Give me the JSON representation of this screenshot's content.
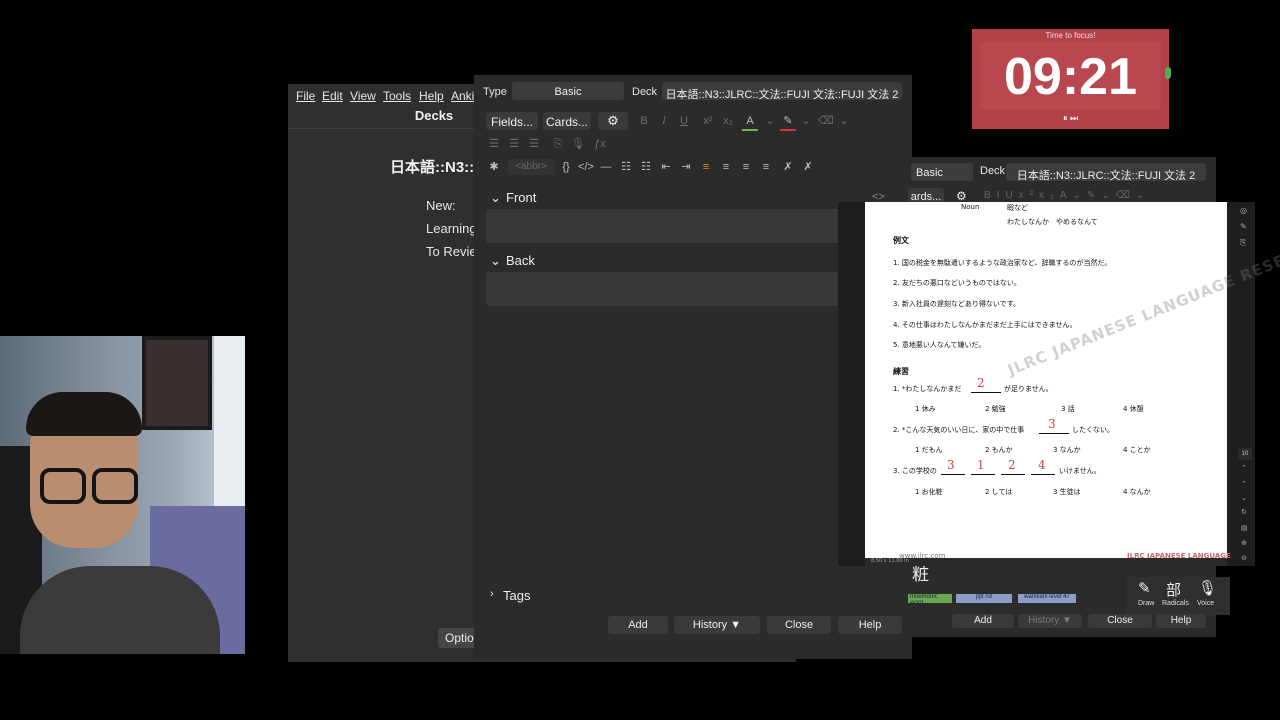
{
  "main_window": {
    "menu": [
      "File",
      "Edit",
      "View",
      "Tools",
      "Help",
      "Anki"
    ],
    "title": "Decks",
    "deck_name": "日本語::N3::",
    "stats": [
      "New:",
      "Learning",
      "To Revie"
    ],
    "options_label": "Optio"
  },
  "add_dialog": {
    "type_label": "Type",
    "type_value": "Basic",
    "deck_label": "Deck",
    "deck_value": "日本語::N3::JLRC::文法::FUJI 文法::FUJI 文法 2",
    "fields_button": "Fields...",
    "cards_button": "Cards...",
    "abbr_label": "<abbr>",
    "fields": [
      "Front",
      "Back"
    ],
    "tags_label": "Tags",
    "buttons": [
      "Add",
      "History ▼",
      "Close",
      "Help"
    ]
  },
  "editor2": {
    "type_value": "Basic",
    "deck_label": "Deck",
    "deck_value": "日本語::N3::JLRC::文法::FUJI 文法 2",
    "cards_partial": "ards...",
    "kanji_display": "粧",
    "tags": [
      "mnemonic word",
      "jlpt n3",
      "wanikani level 47"
    ],
    "tools": [
      "Draw",
      "Radicals",
      "Voice"
    ],
    "buttons": [
      "Add",
      "History ▼",
      "Close",
      "Help"
    ],
    "page_number": "10"
  },
  "pdf": {
    "header_noun": "Noun",
    "header_1": "暇など",
    "header_2": "わたしなんか　やめるなんて",
    "section_examples": "例文",
    "examples": [
      "1. 国の税金を無駄遣いするような政治家など、辞職するのが当然だ。",
      "2. 友だちの悪口などいうものではない。",
      "3. 新入社員の遅刻などあり得ないです。",
      "4. その仕事はわたしなんかまだまだ上手にはできません。",
      "5. 意地悪い人なんて嫌いだ。"
    ],
    "section_practice": "練習",
    "q1": "1. *わたしなんかまだ",
    "q1_end": "が足りません。",
    "q1_answer": "2",
    "q1_options": [
      "1 休み",
      "2 勉強",
      "3 話",
      "4 休憩"
    ],
    "q2": "2. *こんな天気のいい日に、家の中で仕事",
    "q2_end": "したくない。",
    "q2_answer": "3",
    "q2_options": [
      "1 だもん",
      "2 もんか",
      "3 なんか",
      "4 ことか"
    ],
    "q3": "3. この学校の",
    "q3_end": "いけません。",
    "q3_answers": [
      "3",
      "1",
      "2",
      "4"
    ],
    "q3_options": [
      "1 お化粧",
      "2 しては",
      "3 生徒は",
      "4 なんか"
    ],
    "watermark": "JLRC JAPANESE LANGUAGE RESEARCH CENTER",
    "footer_url": "www.jlrc.com",
    "footer_size": "8.50 x 11.00 in",
    "footer_logo": "JLRC JAPANESE LANGUAGE"
  },
  "timer": {
    "caption": "Time to focus!",
    "time": "09:21",
    "controls": "⏸ ⏭"
  },
  "colors": {
    "timer_bg": "#b3414a",
    "dialog_bg": "#2b2b2b",
    "field_bg": "#383838",
    "accent_red": "#c33"
  }
}
